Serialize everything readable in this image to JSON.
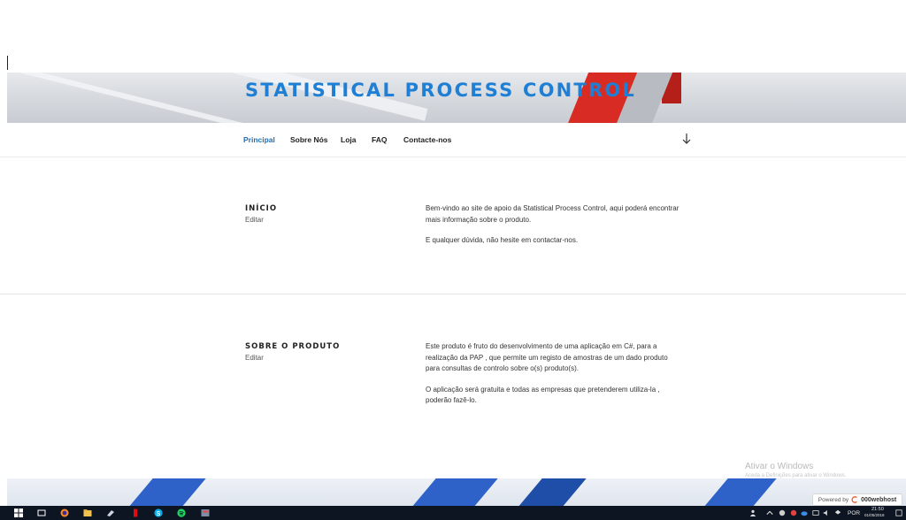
{
  "site": {
    "title": "STATISTICAL PROCESS CONTROL"
  },
  "nav": {
    "items": [
      {
        "label": "Principal",
        "active": true
      },
      {
        "label": "Sobre Nós",
        "active": false
      },
      {
        "label": "Loja",
        "active": false
      },
      {
        "label": "FAQ",
        "active": false
      },
      {
        "label": "Contacte-nos",
        "active": false
      }
    ],
    "scroll_icon": "arrow-down-icon"
  },
  "sections": [
    {
      "title": "INÍCIO",
      "edit_label": "Editar",
      "paragraphs": [
        "Bem-vindo ao site de apoio da Statistical Process Control, aqui poderá encontrar mais informação sobre o produto.",
        "E qualquer dúvida, não hesite em contactar-nos."
      ]
    },
    {
      "title": "SOBRE O PRODUTO",
      "edit_label": "Editar",
      "paragraphs": [
        "Este produto é fruto do desenvolvimento de uma aplicação em C#, para a realização da PAP , que permite um registo de amostras de um dado produto para consultas de controlo sobre o(s) produto(s).",
        "O aplicação será gratuita e todas as empresas que pretenderem utiliza-la , poderão fazê-lo."
      ]
    }
  ],
  "overlay": {
    "watermark_title": "Ativar o Windows",
    "watermark_sub": "Aceda a Definições para ativar o Windows.",
    "powered_by": "Powered by",
    "powered_brand": "000webhost"
  },
  "taskbar": {
    "icons": [
      "windows-start-icon",
      "task-view-icon",
      "firefox-icon",
      "file-explorer-icon",
      "paint-icon",
      "netflix-icon",
      "skype-icon",
      "spotify-icon",
      "app-icon"
    ],
    "language": "POR",
    "time": "21:50",
    "date": "01/05/2018"
  },
  "colors": {
    "title": "#1f7fd4",
    "nav_active": "#1f6fb5",
    "banner_accent": "#d82b23",
    "footer_accent": "#2e62c9",
    "taskbar": "#0d1522"
  }
}
